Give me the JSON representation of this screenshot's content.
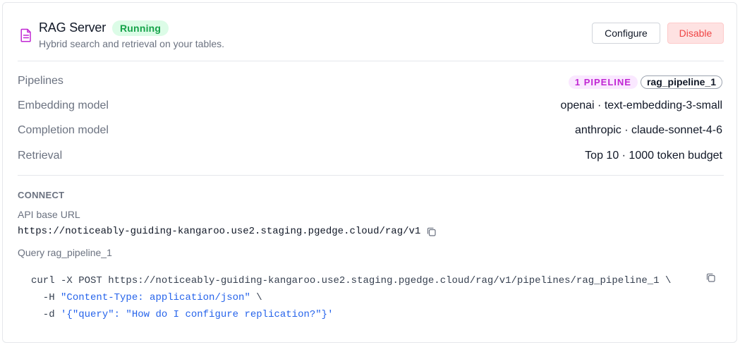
{
  "header": {
    "title": "RAG Server",
    "status": "Running",
    "subtitle": "Hybrid search and retrieval on your tables.",
    "configure_label": "Configure",
    "disable_label": "Disable",
    "icon": "document-icon"
  },
  "details": {
    "pipelines": {
      "label": "Pipelines",
      "count_badge": "1 PIPELINE",
      "pipeline_name": "rag_pipeline_1"
    },
    "embedding_model": {
      "label": "Embedding model",
      "value": "openai · text-embedding-3-small"
    },
    "completion_model": {
      "label": "Completion model",
      "value": "anthropic · claude-sonnet-4-6"
    },
    "retrieval": {
      "label": "Retrieval",
      "value": "Top 10 · 1000 token budget"
    }
  },
  "connect": {
    "title": "CONNECT",
    "api_label": "API base URL",
    "api_url": "https://noticeably-guiding-kangaroo.use2.staging.pgedge.cloud/rag/v1",
    "query_label": "Query rag_pipeline_1",
    "code": {
      "line1": "curl -X POST https://noticeably-guiding-kangaroo.use2.staging.pgedge.cloud/rag/v1/pipelines/rag_pipeline_1 \\",
      "line2_flag": "  -H ",
      "line2_str": "\"Content-Type: application/json\"",
      "line2_tail": " \\",
      "line3_flag": "  -d ",
      "line3_str": "'{\"query\": \"How do I configure replication?\"}'"
    }
  },
  "colors": {
    "status_bg": "#dcfce7",
    "status_fg": "#16a34a",
    "disable_bg": "#fee2e2",
    "disable_fg": "#ef4444",
    "pill_bg": "#fae8ff",
    "pill_fg": "#c026d3",
    "icon": "#c026d3",
    "code_string": "#2563eb"
  }
}
